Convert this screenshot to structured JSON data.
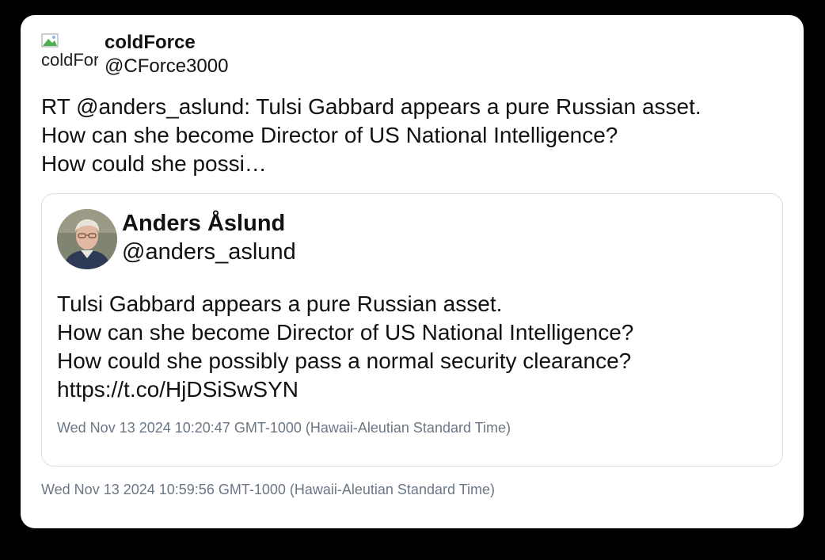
{
  "tweet": {
    "author": {
      "avatar_alt": "coldForce",
      "display_name": "coldForce",
      "handle": "@CForce3000"
    },
    "text_lines": [
      "RT @anders_aslund: Tulsi Gabbard appears a pure Russian asset.",
      "How can she become Director of US National Intelligence?",
      "How could she possi…"
    ],
    "timestamp": "Wed Nov 13 2024 10:59:56 GMT-1000 (Hawaii-Aleutian Standard Time)"
  },
  "quoted_tweet": {
    "author": {
      "display_name": "Anders Åslund",
      "handle": "@anders_aslund"
    },
    "text_lines": [
      "Tulsi Gabbard appears a pure Russian asset.",
      "How can she become Director of US National Intelligence?",
      "How could she possibly pass a normal security clearance?",
      "https://t.co/HjDSiSwSYN"
    ],
    "timestamp": "Wed Nov 13 2024 10:20:47 GMT-1000 (Hawaii-Aleutian Standard Time)"
  }
}
